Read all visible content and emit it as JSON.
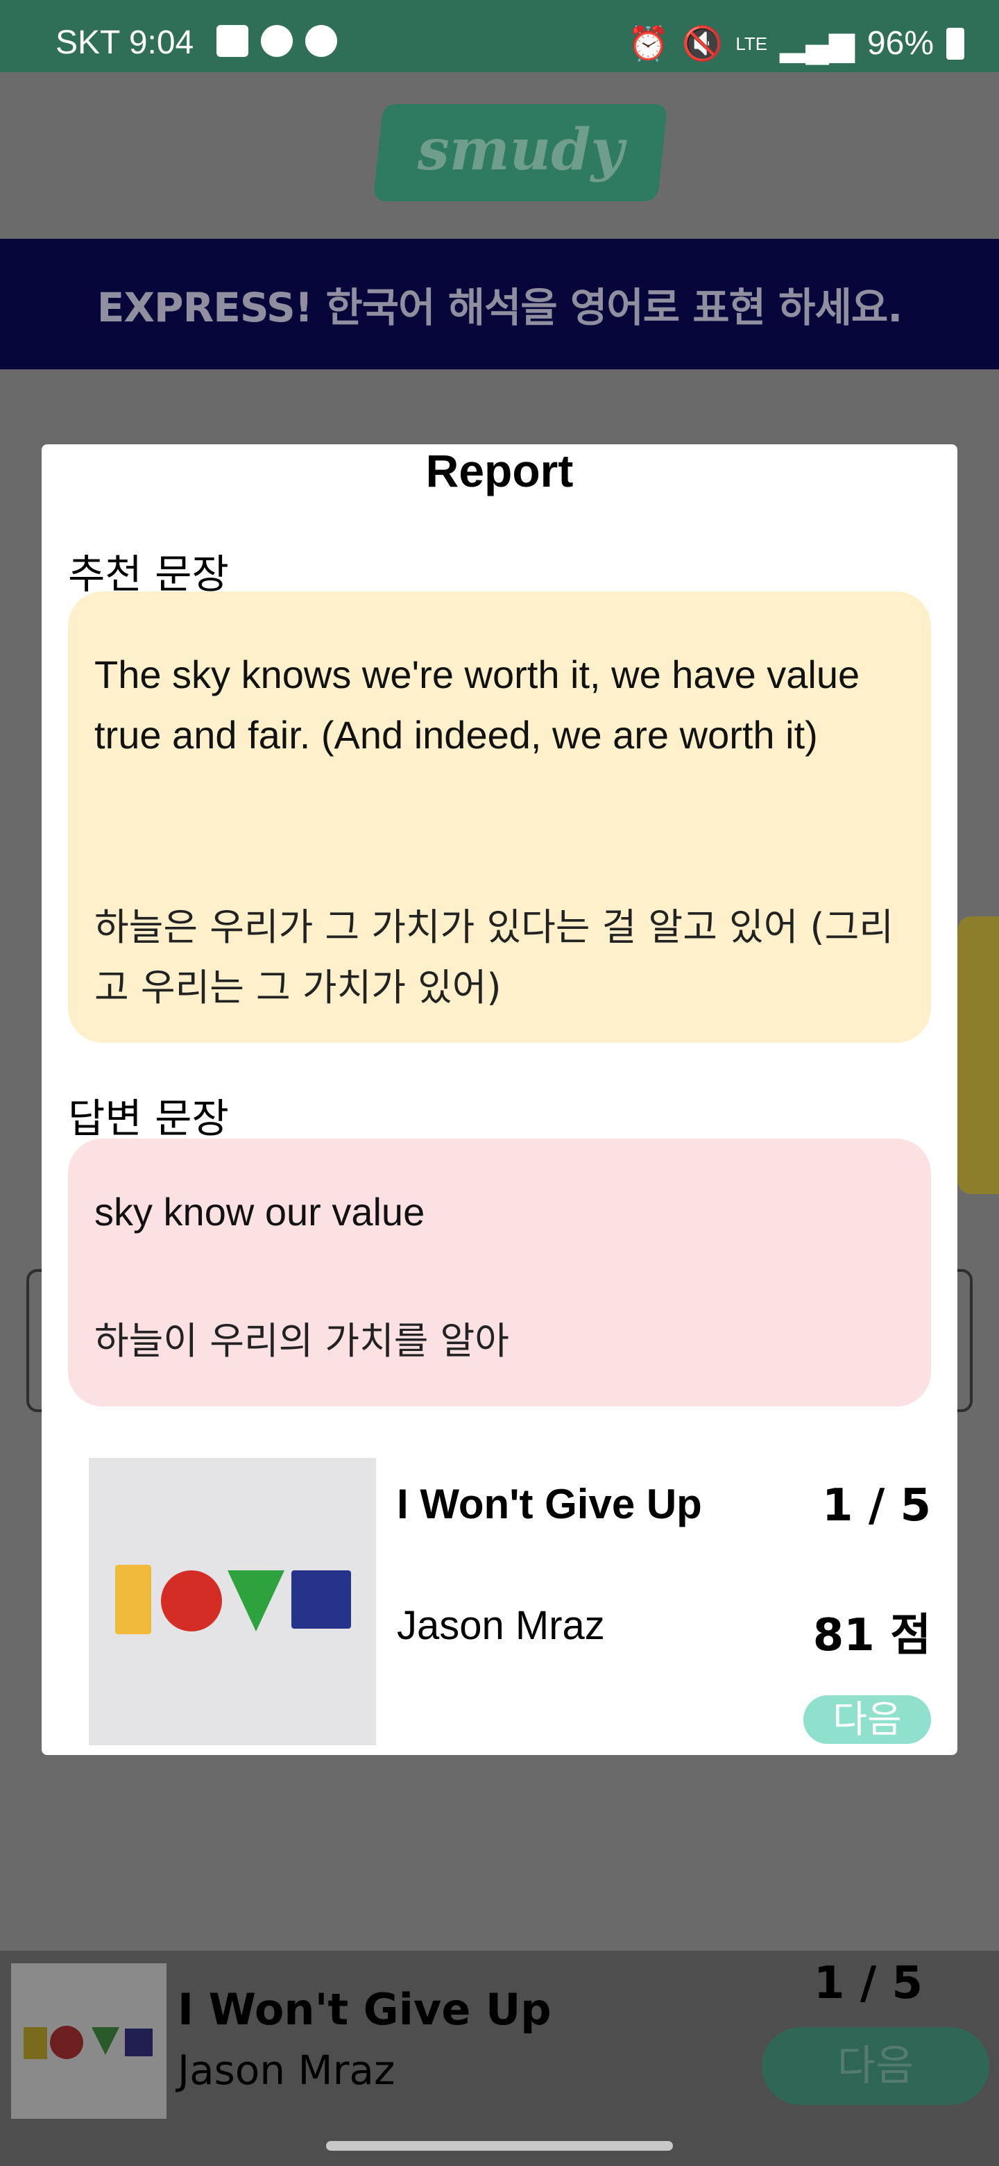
{
  "status_bar": {
    "time": "SKT 9:04",
    "network": "LTE",
    "battery": "96%"
  },
  "app": {
    "logo": "smudy",
    "banner": "EXPRESS! 한국어 해석을 영어로 표현 하세요."
  },
  "report": {
    "title": "Report",
    "recommended_label": "추천 문장",
    "recommended_en": "The sky knows we're worth it, we have value true and fair. (And indeed, we are worth it)",
    "recommended_ko": "하늘은 우리가 그 가치가 있다는 걸 알고 있어 (그리고 우리는 그 가치가 있어)",
    "answer_label": "답변 문장",
    "answer_en": "sky know our value",
    "answer_ko": "하늘이 우리의 가치를 알아",
    "song": {
      "title": "I Won't Give Up",
      "artist": "Jason Mraz",
      "progress": "1 / 5",
      "score": "81 점",
      "next_label": "다음"
    }
  },
  "player": {
    "title": "I Won't Give Up",
    "artist": "Jason Mraz",
    "progress": "1 / 5",
    "next_label": "다음"
  },
  "colors": {
    "status_bar": "#2f6f58",
    "banner": "#06063a",
    "recommended_card": "#fdf0ca",
    "answer_card": "#fce1e2",
    "next_button": "#8fe0cc"
  }
}
